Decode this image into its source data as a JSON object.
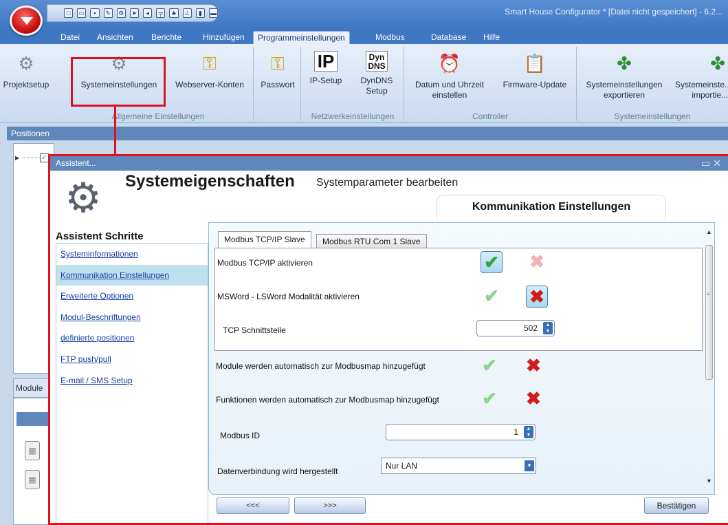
{
  "app": {
    "title": "Smart House Configurator * [Datei nicht gespeichert] - 6.2..."
  },
  "ribbon_tabs": [
    "Datei",
    "Ansichten",
    "Berichte",
    "Hinzufügen",
    "Programmeinstellungen",
    "Modbus",
    "Database",
    "Hilfe"
  ],
  "active_tab": "Programmeinstellungen",
  "ribbon": {
    "buttons": [
      {
        "label": "Projektsetup",
        "icon": "gear-icon"
      },
      {
        "label": "Systemeinstellungen",
        "icon": "gear-icon"
      },
      {
        "label": "Webserver-Konten",
        "icon": "key-icon"
      },
      {
        "label": "Passwort",
        "icon": "key-icon"
      },
      {
        "label": "IP-Setup",
        "icon_text": "IP"
      },
      {
        "label": "DynDNS Setup",
        "icon_text": "Dyn DNS"
      },
      {
        "label": "Datum und Uhrzeit einstellen",
        "icon": "clock-icon"
      },
      {
        "label": "Firmware-Update",
        "icon": "clipboard-icon"
      },
      {
        "label": "Systemeinstellungen exportieren",
        "icon": "money-icon"
      },
      {
        "label": "Systemeinste... importie...",
        "icon": "money-icon"
      }
    ],
    "groups": [
      "Allgemeine Einstellungen",
      "Netzwerkeinstellungen",
      "Controller",
      "Systemeinstellungen"
    ]
  },
  "panels": {
    "positions_title": "Positionen",
    "modules_title": "Module"
  },
  "dialog": {
    "window_title": "Assistent...",
    "heading": "Systemeigenschaften",
    "subheading": "Systemparameter bearbeiten",
    "section_title": "Kommunikation Einstellungen",
    "steps_title": "Assistent Schritte",
    "steps": [
      "Systeminformationen",
      "Kommunikation Einstellungen",
      "Erweiterte Optionen",
      "Modul-Beschriftungen",
      "definierte positionen",
      "FTP push/pull",
      "E-mail / SMS Setup"
    ],
    "active_step": "Kommunikation Einstellungen",
    "content_tabs": [
      "Modbus TCP/IP Slave",
      "Modbus RTU Com 1 Slave"
    ],
    "active_content_tab": "Modbus TCP/IP Slave",
    "rows": {
      "tcp_enable": {
        "label": "Modbus TCP/IP aktivieren",
        "value": true
      },
      "msword": {
        "label": "MSWord - LSWord Modalität aktivieren",
        "value": false
      },
      "tcp_port": {
        "label": "TCP Schnittstelle",
        "value": "502"
      },
      "modules_auto": {
        "label": "Module werden automatisch zur Modbusmap hinzugefügt",
        "value": false
      },
      "functions_auto": {
        "label": "Funktionen  werden automatisch zur Modbusmap hinzugefügt",
        "value": false
      },
      "modbus_id": {
        "label": "Modbus ID",
        "value": "1"
      },
      "connection": {
        "label": "Datenverbindung wird hergestellt",
        "value": "Nur LAN"
      }
    },
    "buttons": {
      "prev": "<<<",
      "next": ">>>",
      "confirm": "Bestätigen"
    }
  },
  "colors": {
    "highlight": "#e0101f",
    "ribbon_blue": "#3f77c2",
    "panel_header": "#5f87bc",
    "link": "#1840a8"
  }
}
